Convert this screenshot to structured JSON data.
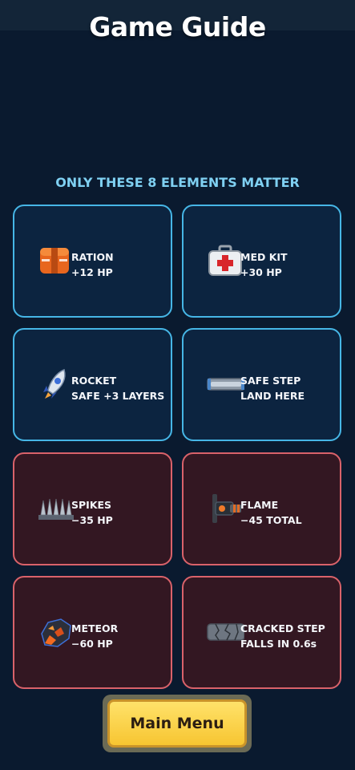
{
  "header": {
    "title": "Game Guide"
  },
  "subtitle": "ONLY THESE 8 ELEMENTS MATTER",
  "items": [
    {
      "name": "RATION",
      "effect": "+12 HP",
      "kind": "good",
      "icon": "ration-crate-icon"
    },
    {
      "name": "MED KIT",
      "effect": "+30 HP",
      "kind": "good",
      "icon": "medkit-icon"
    },
    {
      "name": "ROCKET",
      "effect": "SAFE +3 LAYERS",
      "kind": "good",
      "icon": "rocket-icon"
    },
    {
      "name": "SAFE STEP",
      "effect": "LAND HERE",
      "kind": "good",
      "icon": "safe-step-icon"
    },
    {
      "name": "SPIKES",
      "effect": "−35 HP",
      "kind": "bad",
      "icon": "spikes-icon"
    },
    {
      "name": "FLAME",
      "effect": "−45 TOTAL",
      "kind": "bad",
      "icon": "flame-icon"
    },
    {
      "name": "METEOR",
      "effect": "−60 HP",
      "kind": "bad",
      "icon": "meteor-icon"
    },
    {
      "name": "CRACKED STEP",
      "effect": "FALLS IN 0.6s",
      "kind": "bad",
      "icon": "cracked-step-icon"
    }
  ],
  "footer": {
    "main_menu_label": "Main Menu"
  },
  "colors": {
    "good_border": "#46b6e6",
    "bad_border": "#d9626a",
    "button": "#f7c531"
  }
}
